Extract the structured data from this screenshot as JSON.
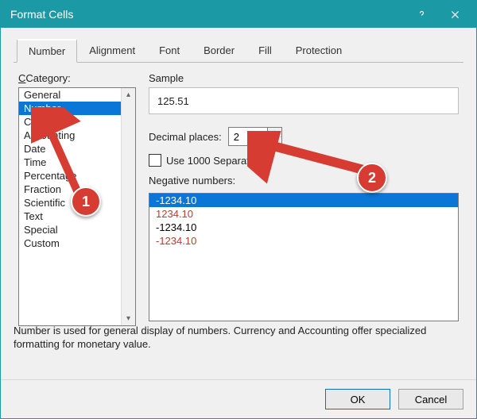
{
  "window": {
    "title": "Format Cells"
  },
  "tabs": [
    "Number",
    "Alignment",
    "Font",
    "Border",
    "Fill",
    "Protection"
  ],
  "category": {
    "label": "Category:",
    "items": [
      "General",
      "Number",
      "Currency",
      "Accounting",
      "Date",
      "Time",
      "Percentage",
      "Fraction",
      "Scientific",
      "Text",
      "Special",
      "Custom"
    ],
    "selected_index": 1
  },
  "sample": {
    "label": "Sample",
    "value": "125.51"
  },
  "decimal": {
    "label": "Decimal places:",
    "value": "2"
  },
  "separator": {
    "label": "Use 1000 Separator (,)",
    "checked": false
  },
  "negative": {
    "label": "Negative numbers:",
    "items": [
      {
        "text": "-1234.10",
        "color": "#ffffff",
        "selected": true
      },
      {
        "text": "1234.10",
        "color": "#c0392b",
        "selected": false
      },
      {
        "text": "-1234.10",
        "color": "#000000",
        "selected": false
      },
      {
        "text": "-1234.10",
        "color": "#c0392b",
        "selected": false
      }
    ]
  },
  "description": "Number is used for general display of numbers.  Currency and Accounting offer specialized formatting for monetary value.",
  "buttons": {
    "ok": "OK",
    "cancel": "Cancel"
  },
  "annotations": {
    "c1": "1",
    "c2": "2"
  }
}
